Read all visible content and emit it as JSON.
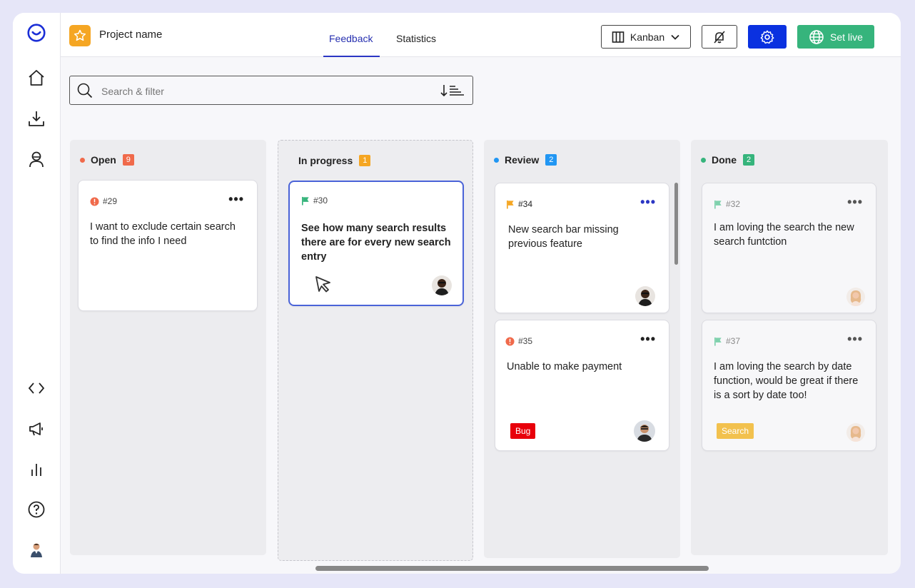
{
  "header": {
    "project_name": "Project name",
    "tabs": [
      {
        "label": "Feedback",
        "active": true
      },
      {
        "label": "Statistics",
        "active": false
      }
    ],
    "view_select": "Kanban",
    "set_live_label": "Set live"
  },
  "search": {
    "placeholder": "Search & filter"
  },
  "sidebar": {
    "items": [
      "logo-icon",
      "home-icon",
      "download-icon",
      "user-icon",
      "code-icon",
      "megaphone-icon",
      "bar-chart-icon",
      "help-icon",
      "avatar"
    ]
  },
  "columns": [
    {
      "title": "Open",
      "count": "9",
      "color": "#f06a4b",
      "cards": [
        {
          "id": "#29",
          "type": "alert",
          "text": "I want to exclude certain search to find the info I need"
        }
      ]
    },
    {
      "title": "In progress",
      "count": "1",
      "color": "#f5a623",
      "cards": [
        {
          "id": "#30",
          "type": "flag-green",
          "text": "See how many search results there are for every new search entry"
        }
      ]
    },
    {
      "title": "Review",
      "count": "2",
      "color": "#2196f3",
      "cards": [
        {
          "id": "#34",
          "type": "flag-orange",
          "text": "New search bar missing previous feature"
        },
        {
          "id": "#35",
          "type": "alert",
          "text": "Unable to make payment",
          "tag": "Bug"
        }
      ]
    },
    {
      "title": "Done",
      "count": "2",
      "color": "#36b47c",
      "cards": [
        {
          "id": "#32",
          "type": "flag-green",
          "text": "I am loving the search the new search funtction"
        },
        {
          "id": "#37",
          "type": "flag-green",
          "text": "I am loving the search by date function, would be great if there is a sort by date too!",
          "tag": "Search"
        }
      ]
    }
  ],
  "colors": {
    "accent": "#2b36c4",
    "gear_button": "#0a31e0",
    "live_button": "#36b47c",
    "bug_tag": "#e8000b",
    "search_tag": "#f2c14e"
  }
}
